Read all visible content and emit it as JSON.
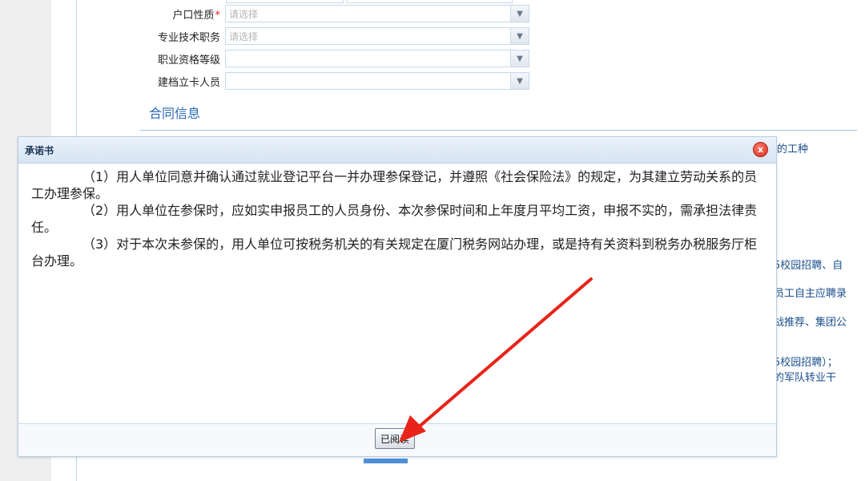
{
  "form": {
    "fields": [
      {
        "label": "户口性质",
        "required": true,
        "placeholder": "请选择"
      },
      {
        "label": "专业技术职务",
        "required": false,
        "placeholder": "请选择"
      },
      {
        "label": "职业资格等级",
        "required": false,
        "placeholder": ""
      },
      {
        "label": "建档立卡人员",
        "required": false,
        "placeholder": ""
      }
    ],
    "required_mark": "*",
    "section_title": "合同信息"
  },
  "background_snippets": [
    "的工种",
    "5校园招聘、自",
    "员工自主应聘录",
    "战推荐、集团公",
    "5校园招聘）；",
    "的军队转业干"
  ],
  "dialog": {
    "title": "承诺书",
    "close_glyph": "x",
    "paragraphs": [
      "（1）用人单位同意并确认通过就业登记平台一并办理参保登记，并遵照《社会保险法》的规定，为其建立劳动关系的员工办理参保。",
      "（2）用人单位在参保时，应如实申报员工的人员身份、本次参保时间和上年度月平均工资，申报不实的，需承担法律责任。",
      "（3）对于本次未参保的，用人单位可按税务机关的有关规定在厦门税务网站办理，或是持有关资料到税务办税服务厅柜台办理。"
    ],
    "confirm_label": "已阅读"
  },
  "colors": {
    "accent": "#2a68b8",
    "annotation_arrow": "#e8231a"
  }
}
